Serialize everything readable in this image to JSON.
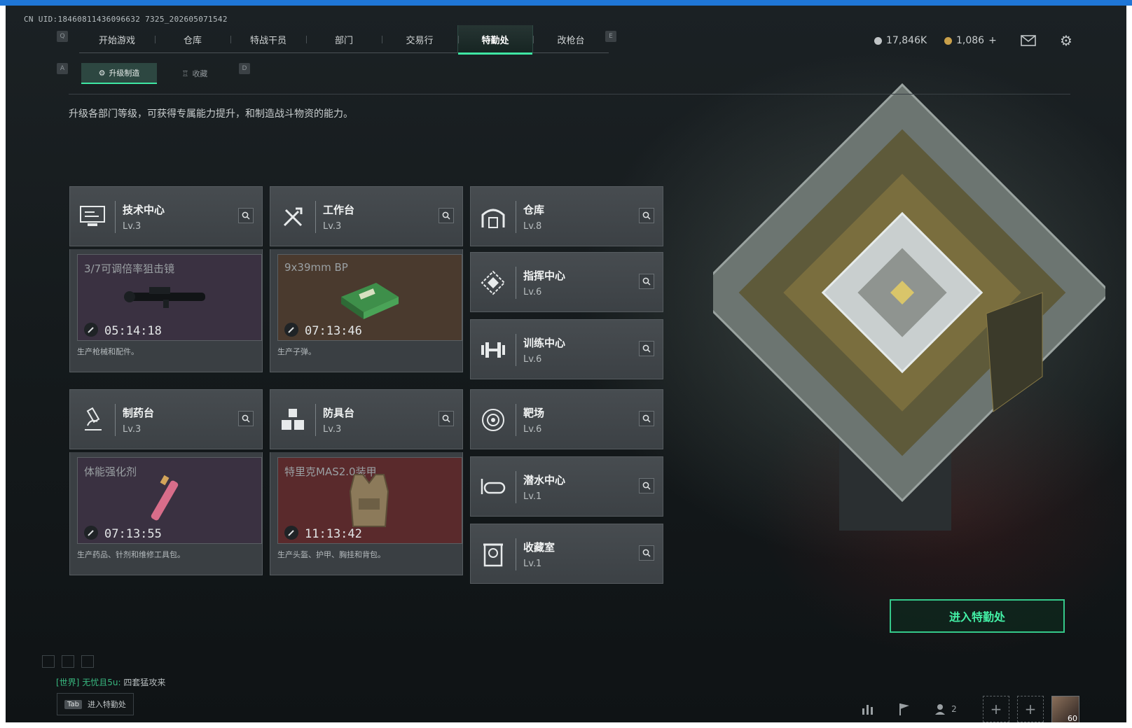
{
  "uid": "CN UID:18460811436096632 7325_202605071542",
  "nav": {
    "key_left": "Q",
    "key_right": "E",
    "items": [
      "开始游戏",
      "仓库",
      "特战干员",
      "部门",
      "交易行",
      "特勤处",
      "改枪台"
    ],
    "active_index": 5
  },
  "subnav": {
    "key_left": "A",
    "key_right": "D",
    "items": [
      "升级制造",
      "收藏"
    ],
    "active_index": 0
  },
  "currency": {
    "silver": "17,846K",
    "gold": "1,086",
    "gold_add": "+"
  },
  "description": "升级各部门等级，可获得专属能力提升，和制造战斗物资的能力。",
  "departments": [
    {
      "name": "技术中心",
      "level": "Lv.3",
      "icon": "computer-icon",
      "craft": {
        "item": "3/7可调倍率狙击镜",
        "timer": "05:14:18",
        "image": "scope-image"
      },
      "desc": "生产枪械和配件。"
    },
    {
      "name": "工作台",
      "level": "Lv.3",
      "icon": "tools-icon",
      "craft": {
        "item": "9x39mm BP",
        "timer": "07:13:46",
        "image": "ammo-box-image"
      },
      "desc": "生产子弹。"
    },
    {
      "name": "仓库",
      "level": "Lv.8",
      "icon": "warehouse-icon"
    },
    {
      "name": "指挥中心",
      "level": "Lv.6",
      "icon": "command-icon"
    },
    {
      "name": "训练中心",
      "level": "Lv.6",
      "icon": "dumbbell-icon"
    },
    {
      "name": "制药台",
      "level": "Lv.3",
      "icon": "microscope-icon",
      "craft": {
        "item": "体能强化剂",
        "timer": "07:13:55",
        "image": "syringe-image"
      },
      "desc": "生产药品、针剂和维修工具包。"
    },
    {
      "name": "防具台",
      "level": "Lv.3",
      "icon": "armor-icon",
      "craft": {
        "item": "特里克MAS2.0装甲",
        "timer": "11:13:42",
        "image": "vest-image"
      },
      "desc": "生产头盔、护甲、胸挂和背包。"
    },
    {
      "name": "靶场",
      "level": "Lv.6",
      "icon": "target-icon"
    },
    {
      "name": "潜水中心",
      "level": "Lv.1",
      "icon": "diving-mask-icon"
    },
    {
      "name": "收藏室",
      "level": "Lv.1",
      "icon": "collection-icon"
    }
  ],
  "enter_button": "进入特勤处",
  "chat": {
    "channel": "[世界]",
    "sender": "无忧且5u:",
    "message": "四套猛攻来"
  },
  "tab_hint": {
    "key": "Tab",
    "label": "进入特勤处"
  },
  "bottom": {
    "squad_count": "2",
    "avatar_level": "60"
  },
  "colors": {
    "accent": "#3fe6a3",
    "panel": "#474c50",
    "craft_purple": "#3a3141",
    "craft_brown": "#4a3a2e",
    "craft_red": "#5a2a2c"
  }
}
